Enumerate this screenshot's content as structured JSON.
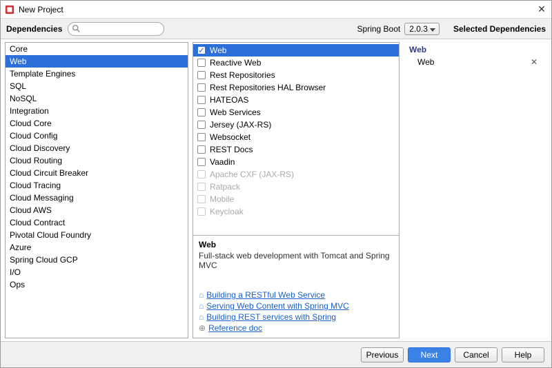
{
  "window": {
    "title": "New Project"
  },
  "toolbar": {
    "dependencies_label": "Dependencies",
    "search_placeholder": "",
    "spring_boot_label": "Spring Boot",
    "spring_boot_version": "2.0.3",
    "selected_dependencies_label": "Selected Dependencies"
  },
  "categories": [
    "Core",
    "Web",
    "Template Engines",
    "SQL",
    "NoSQL",
    "Integration",
    "Cloud Core",
    "Cloud Config",
    "Cloud Discovery",
    "Cloud Routing",
    "Cloud Circuit Breaker",
    "Cloud Tracing",
    "Cloud Messaging",
    "Cloud AWS",
    "Cloud Contract",
    "Pivotal Cloud Foundry",
    "Azure",
    "Spring Cloud GCP",
    "I/O",
    "Ops"
  ],
  "selected_category_index": 1,
  "dependencies": [
    {
      "label": "Web",
      "checked": true,
      "disabled": false
    },
    {
      "label": "Reactive Web",
      "checked": false,
      "disabled": false
    },
    {
      "label": "Rest Repositories",
      "checked": false,
      "disabled": false
    },
    {
      "label": "Rest Repositories HAL Browser",
      "checked": false,
      "disabled": false
    },
    {
      "label": "HATEOAS",
      "checked": false,
      "disabled": false
    },
    {
      "label": "Web Services",
      "checked": false,
      "disabled": false
    },
    {
      "label": "Jersey (JAX-RS)",
      "checked": false,
      "disabled": false
    },
    {
      "label": "Websocket",
      "checked": false,
      "disabled": false
    },
    {
      "label": "REST Docs",
      "checked": false,
      "disabled": false
    },
    {
      "label": "Vaadin",
      "checked": false,
      "disabled": false
    },
    {
      "label": "Apache CXF (JAX-RS)",
      "checked": false,
      "disabled": true
    },
    {
      "label": "Ratpack",
      "checked": false,
      "disabled": true
    },
    {
      "label": "Mobile",
      "checked": false,
      "disabled": true
    },
    {
      "label": "Keycloak",
      "checked": false,
      "disabled": true
    }
  ],
  "selected_dependency_index": 0,
  "detail": {
    "title": "Web",
    "description": "Full-stack web development with Tomcat and Spring MVC",
    "links": [
      "Building a RESTful Web Service",
      "Serving Web Content with Spring MVC",
      "Building REST services with Spring"
    ],
    "reference_doc": "Reference doc"
  },
  "selected": {
    "group": "Web",
    "items": [
      "Web"
    ]
  },
  "footer": {
    "previous": "Previous",
    "next": "Next",
    "cancel": "Cancel",
    "help": "Help"
  }
}
